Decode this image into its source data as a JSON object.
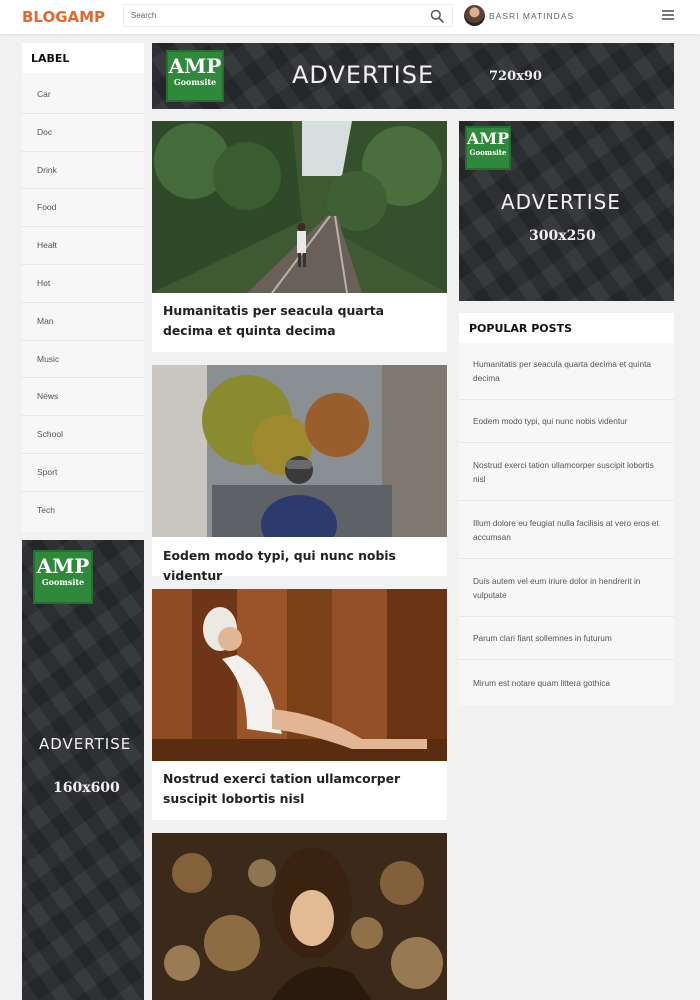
{
  "header": {
    "logo": "BLOGAMP",
    "search_placeholder": "Search",
    "username": "BASRI MATINDAS"
  },
  "sidebar": {
    "title": "LABEL",
    "items": [
      "Car",
      "Doc",
      "Drink",
      "Food",
      "Healt",
      "Hot",
      "Man",
      "Music",
      "News",
      "School",
      "Sport",
      "Tech"
    ]
  },
  "ads": {
    "top": {
      "logo_big": "AMP",
      "logo_small": "Goomsite",
      "text": "ADVERTISE",
      "size": "720x90"
    },
    "right": {
      "logo_big": "AMP",
      "logo_small": "Goomsite",
      "text": "ADVERTISE",
      "size": "300x250"
    },
    "left": {
      "logo_big": "AMP",
      "logo_small": "Goomsite",
      "text": "ADVERTISE",
      "size": "160x600"
    }
  },
  "posts": [
    {
      "title": "Humanitatis per seacula quarta decima et quinta decima"
    },
    {
      "title": "Eodem modo typi, qui nunc nobis videntur"
    },
    {
      "title": "Nostrud exerci tation ullamcorper suscipit lobortis nisl"
    },
    {
      "title": ""
    }
  ],
  "popular": {
    "title": "POPULAR POSTS",
    "items": [
      "Humanitatis per seacula quarta decima et quinta decima",
      "Eodem modo typi, qui nunc nobis videntur",
      "Nostrud exerci tation ullamcorper suscipit lobortis nisl",
      "Illum dolore eu feugiat nulla facilisis at vero eros et accumsan",
      "Duis autem vel eum iriure dolor in hendrerit in vulputate",
      "Parum clari fiant sollemnes in futurum",
      "Mirum est notare quam littera gothica"
    ]
  },
  "colors": {
    "brand": "#e8682c",
    "ad_bg": "#292b2f",
    "amp_green": "#2e8a3a"
  }
}
